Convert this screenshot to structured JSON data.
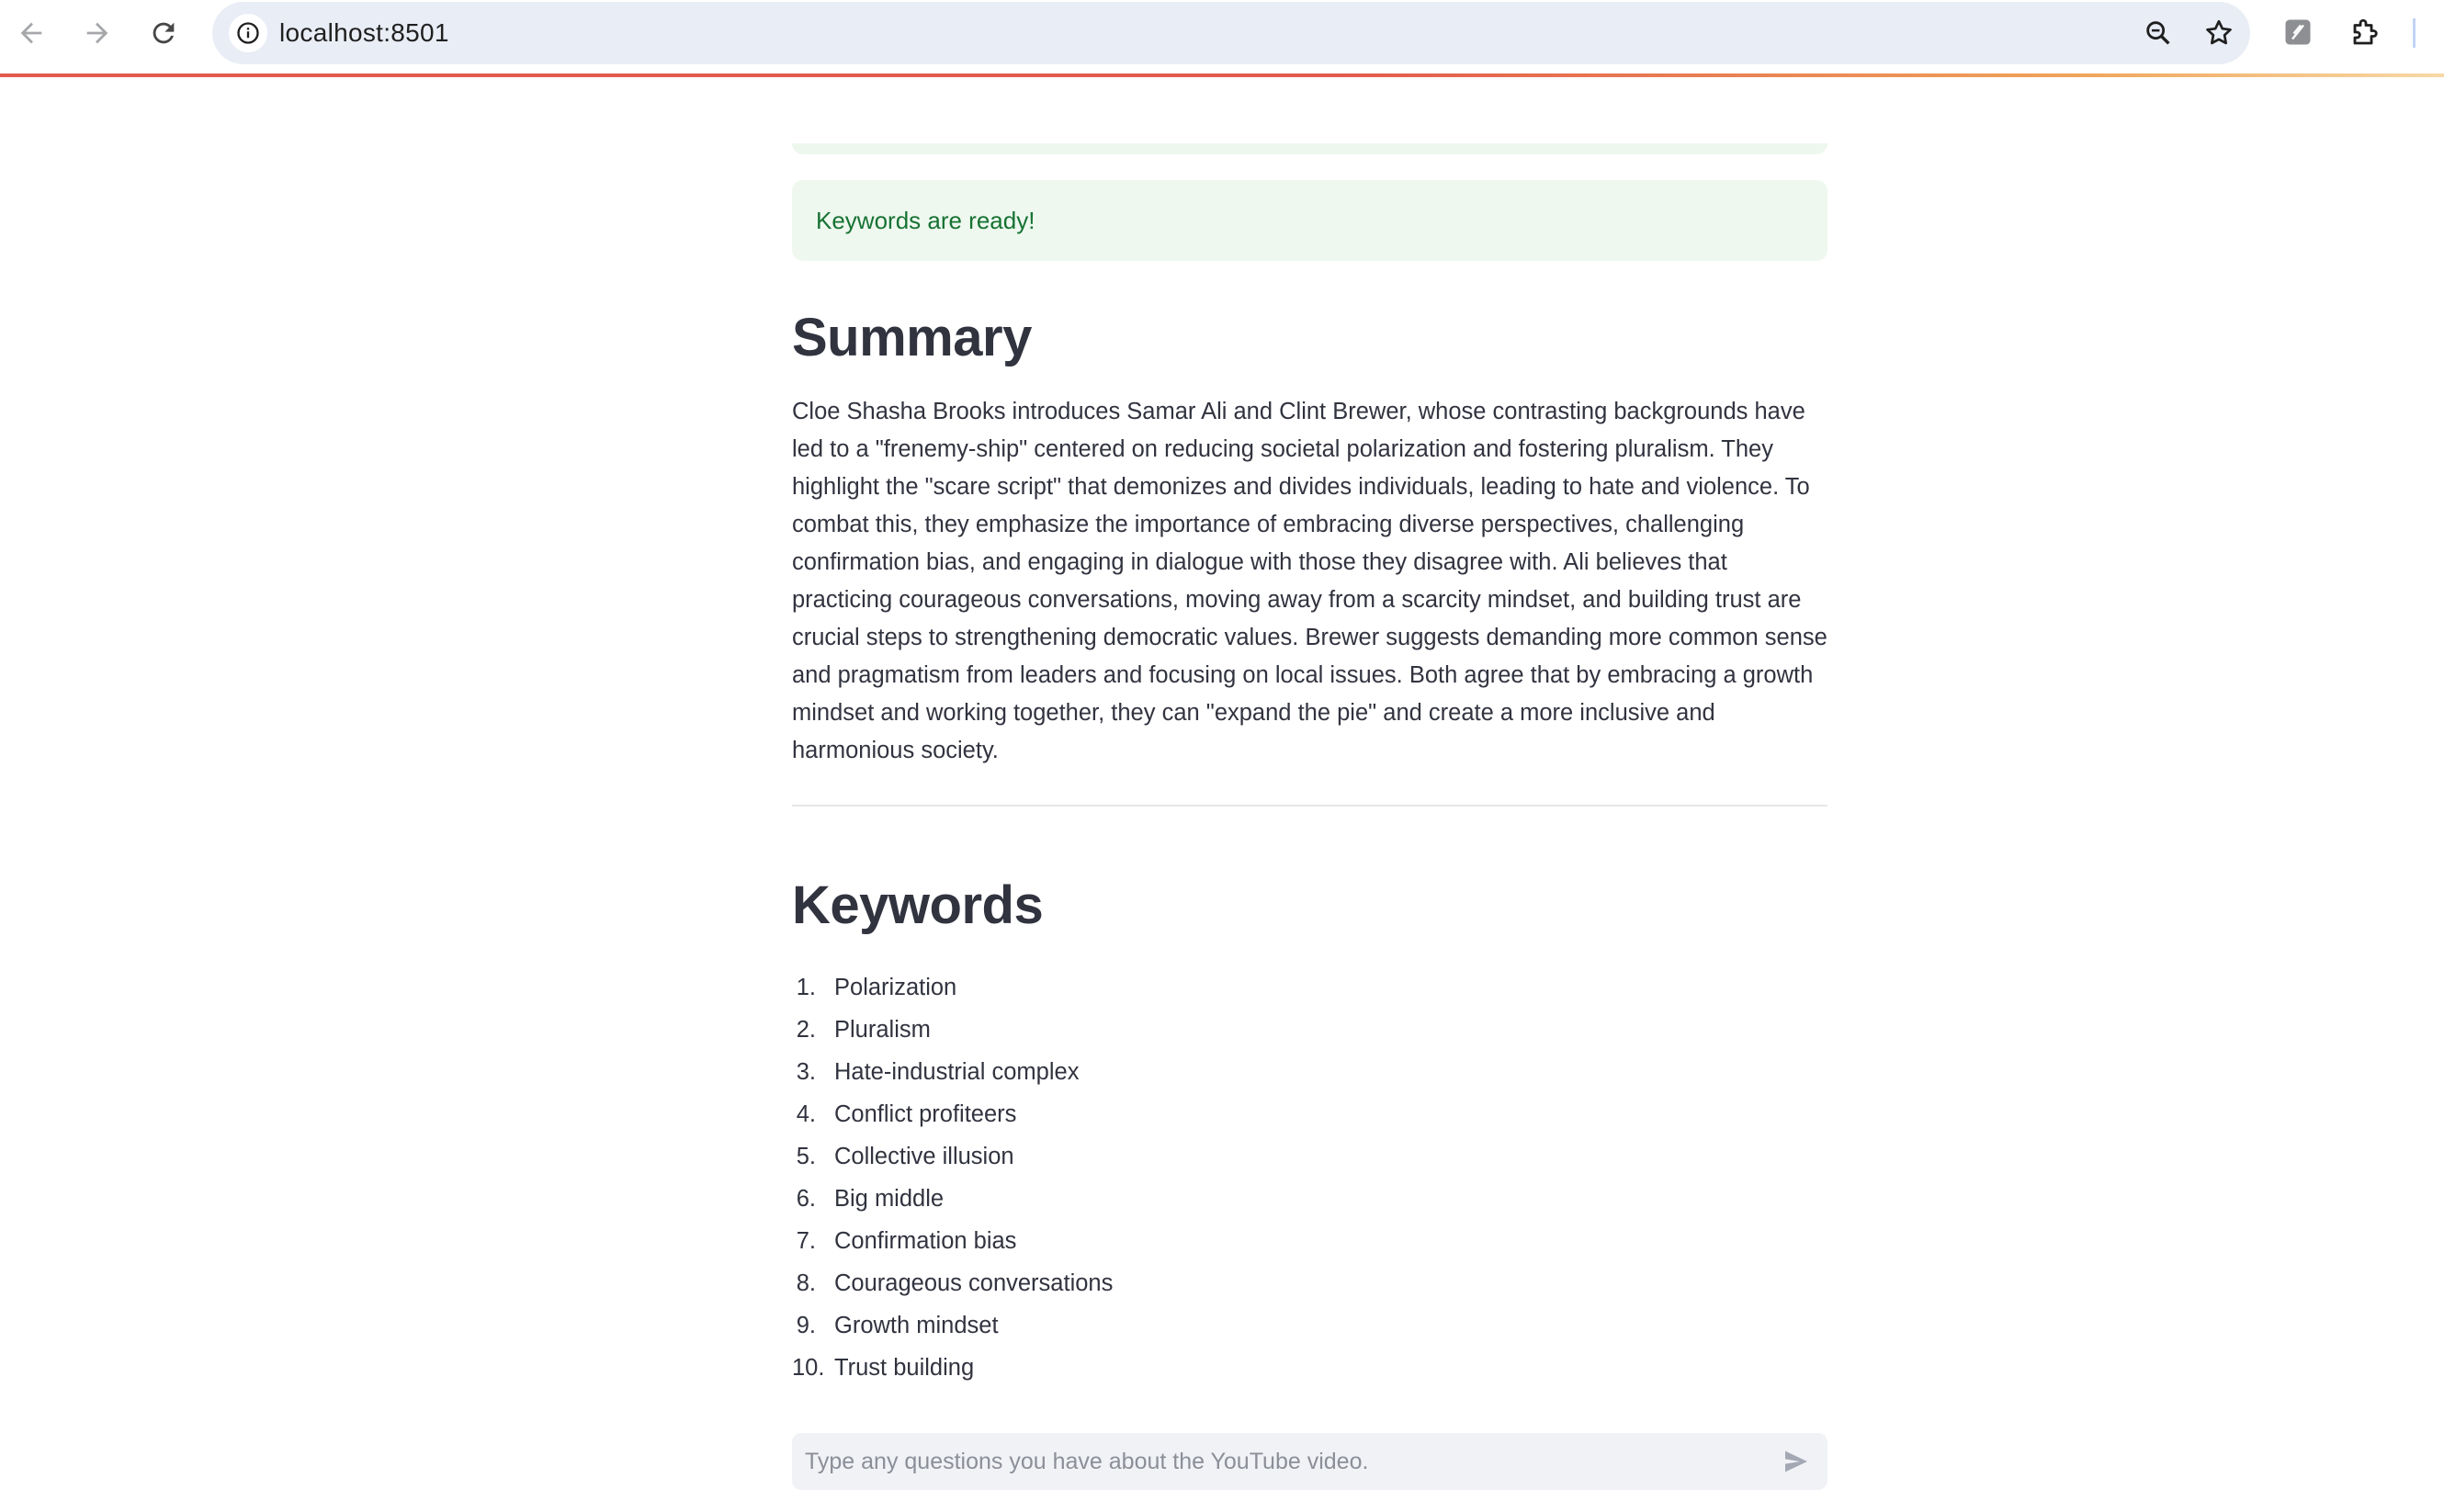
{
  "browser": {
    "url": "localhost:8501"
  },
  "page": {
    "alert_text": "Keywords are ready!",
    "summary": {
      "title": "Summary",
      "text": "Cloe Shasha Brooks introduces Samar Ali and Clint Brewer, whose contrasting backgrounds have led to a \"frenemy-ship\" centered on reducing societal polarization and fostering pluralism. They highlight the \"scare script\" that demonizes and divides individuals, leading to hate and violence. To combat this, they emphasize the importance of embracing diverse perspectives, challenging confirmation bias, and engaging in dialogue with those they disagree with. Ali believes that practicing courageous conversations, moving away from a scarcity mindset, and building trust are crucial steps to strengthening democratic values. Brewer suggests demanding more common sense and pragmatism from leaders and focusing on local issues. Both agree that by embracing a growth mindset and working together, they can \"expand the pie\" and create a more inclusive and harmonious society."
    },
    "keywords": {
      "title": "Keywords",
      "items": [
        {
          "num": "1.",
          "label": "Polarization"
        },
        {
          "num": "2.",
          "label": "Pluralism"
        },
        {
          "num": "3.",
          "label": "Hate-industrial complex"
        },
        {
          "num": "4.",
          "label": "Conflict profiteers"
        },
        {
          "num": "5.",
          "label": "Collective illusion"
        },
        {
          "num": "6.",
          "label": "Big middle"
        },
        {
          "num": "7.",
          "label": "Confirmation bias"
        },
        {
          "num": "8.",
          "label": "Courageous conversations"
        },
        {
          "num": "9.",
          "label": "Growth mindset"
        },
        {
          "num": "10.",
          "label": "Trust building"
        }
      ]
    },
    "chat": {
      "placeholder": "Type any questions you have about the YouTube video."
    }
  },
  "icons": {
    "back": "back-arrow-icon",
    "forward": "forward-arrow-icon",
    "reload": "reload-icon",
    "site_info": "info-icon",
    "zoom": "zoom-icon",
    "bookmark": "star-icon",
    "extension": "extension-icon",
    "puzzle": "puzzle-icon",
    "send": "send-icon"
  },
  "colors": {
    "alert_bg": "#eef8ef",
    "alert_text": "#177233",
    "text": "#31333f",
    "input_bg": "#f0f2f6"
  }
}
